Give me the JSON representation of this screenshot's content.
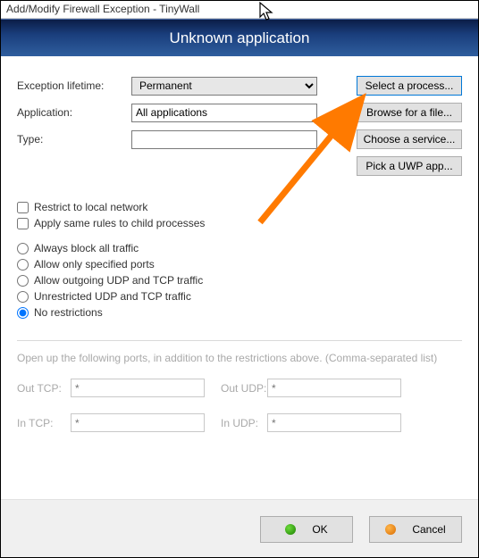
{
  "window": {
    "title": "Add/Modify Firewall Exception - TinyWall"
  },
  "banner": {
    "text": "Unknown application"
  },
  "form": {
    "lifetime_label": "Exception lifetime:",
    "lifetime_value": "Permanent",
    "application_label": "Application:",
    "application_value": "All applications",
    "type_label": "Type:",
    "type_value": ""
  },
  "buttons": {
    "select_process": "Select a process...",
    "browse_file": "Browse for a file...",
    "choose_service": "Choose a service...",
    "pick_uwp": "Pick a UWP app..."
  },
  "checks": {
    "restrict_local": "Restrict to local network",
    "child_processes": "Apply same rules to child processes"
  },
  "radios": {
    "always_block": "Always block all traffic",
    "only_specified": "Allow only specified ports",
    "outgoing_udp_tcp": "Allow outgoing UDP and TCP traffic",
    "unrestricted_udp_tcp": "Unrestricted UDP and TCP traffic",
    "no_restrictions": "No restrictions"
  },
  "ports": {
    "caption": "Open up the following ports, in addition to the restrictions above. (Comma-separated list)",
    "out_tcp_label": "Out TCP:",
    "out_udp_label": "Out UDP:",
    "in_tcp_label": "In TCP:",
    "in_udp_label": "In UDP:",
    "placeholder": "*"
  },
  "dialog": {
    "ok": "OK",
    "cancel": "Cancel"
  }
}
